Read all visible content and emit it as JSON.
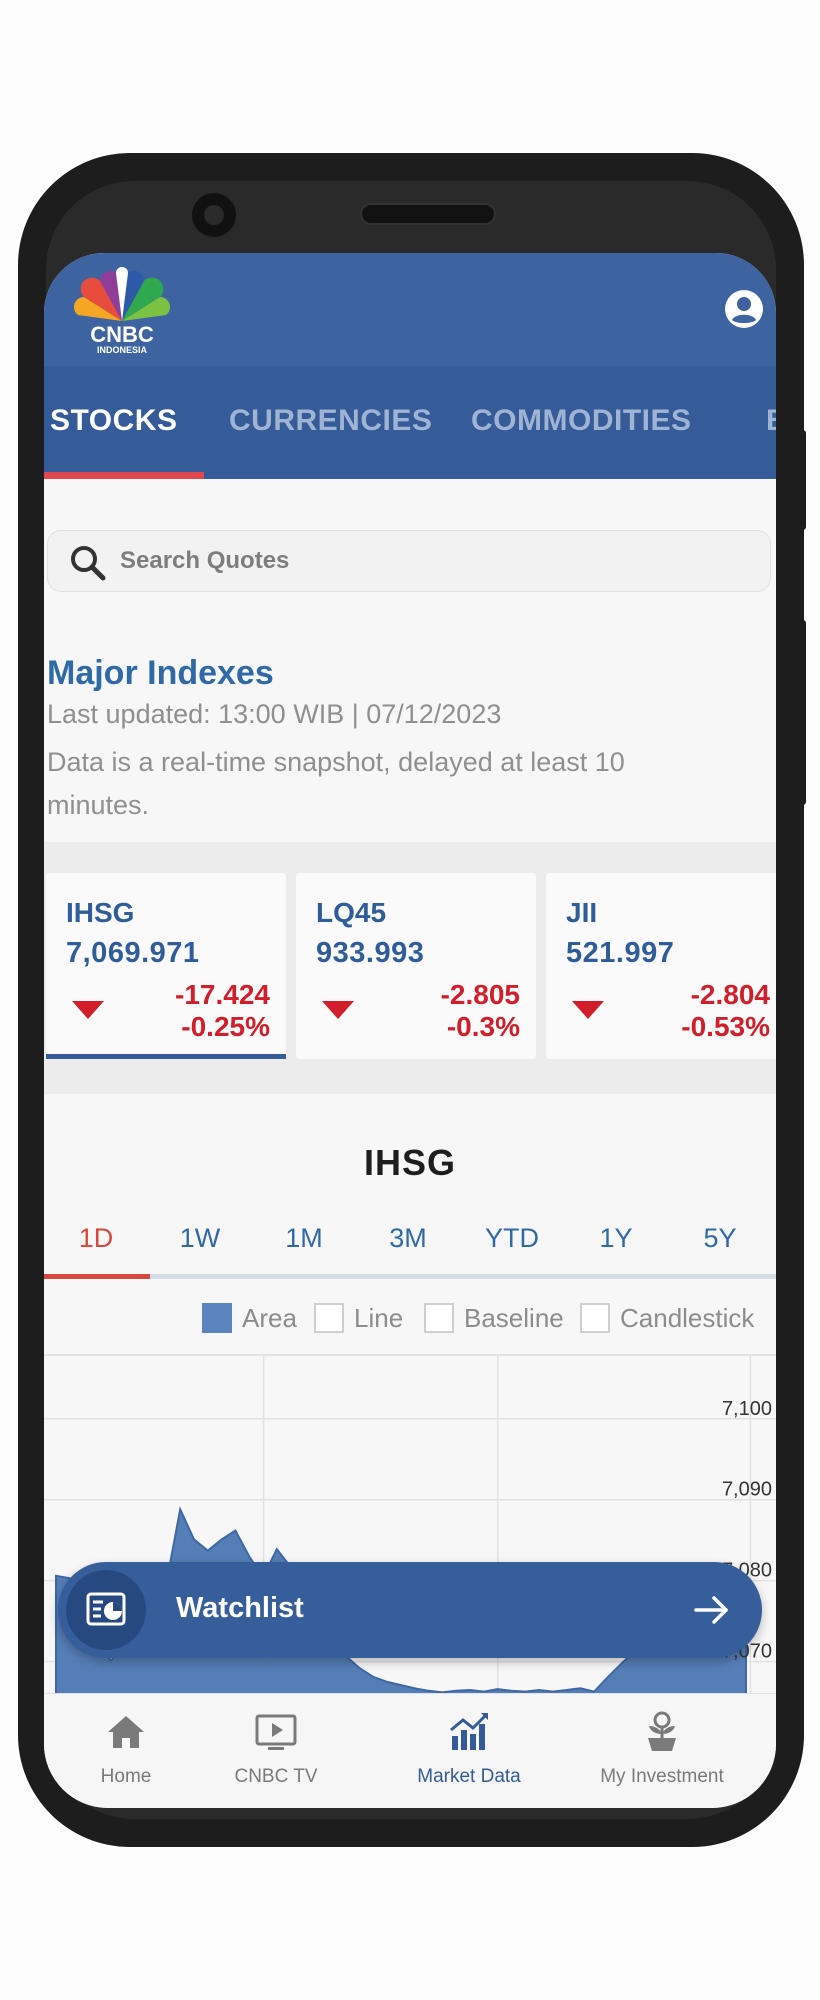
{
  "header": {
    "logo_text": "CNBC",
    "logo_subtext": "INDONESIA",
    "account_icon": "account-circle-icon"
  },
  "tabs": [
    {
      "label": "STOCKS",
      "active": true
    },
    {
      "label": "CURRENCIES",
      "active": false
    },
    {
      "label": "COMMODITIES",
      "active": false
    },
    {
      "label": "B",
      "active": false
    }
  ],
  "search": {
    "placeholder": "Search Quotes",
    "icon": "search-icon"
  },
  "major_indexes": {
    "title": "Major Indexes",
    "last_updated": "Last updated: 13:00 WIB | 07/12/2023",
    "note": "Data is a real-time snapshot, delayed at least 10 minutes."
  },
  "index_cards": [
    {
      "name": "IHSG",
      "value": "7,069.971",
      "change": "-17.424",
      "pct": "-0.25%",
      "selected": true
    },
    {
      "name": "LQ45",
      "value": "933.993",
      "change": "-2.805",
      "pct": "-0.3%",
      "selected": false
    },
    {
      "name": "JII",
      "value": "521.997",
      "change": "-2.804",
      "pct": "-0.53%",
      "selected": false
    }
  ],
  "chart_section": {
    "title": "IHSG",
    "periods": [
      "1D",
      "1W",
      "1M",
      "3M",
      "YTD",
      "1Y",
      "5Y"
    ],
    "active_period": "1D",
    "types": [
      {
        "label": "Area",
        "checked": true
      },
      {
        "label": "Line",
        "checked": false
      },
      {
        "label": "Baseline",
        "checked": false
      },
      {
        "label": "Candlestick",
        "checked": false
      }
    ]
  },
  "chart_data": {
    "type": "area",
    "y_ticks": [
      "7,100",
      "7,090",
      "7,080",
      "7,070"
    ],
    "ylim": [
      7066,
      7108
    ],
    "grid": true,
    "series": [
      {
        "color": "#4b77b1",
        "values": [
          7080.6,
          7080.3,
          7074.0,
          7072.2,
          7070.1,
          7072.6,
          7074.6,
          7076.8,
          7079.7,
          7088.8,
          7085.1,
          7083.7,
          7085.1,
          7086.2,
          7083.0,
          7080.4,
          7083.9,
          7081.7,
          7078.8,
          7076.2,
          7072.8,
          7070.7,
          7069.2,
          7068.1,
          7067.5,
          7067.1,
          7066.7,
          7066.4,
          7066.2,
          7066.4,
          7066.5,
          7066.3,
          7066.6,
          7066.4,
          7066.3,
          7066.5,
          7066.3,
          7066.5,
          7066.7,
          7066.3,
          7068.1,
          7069.8,
          7071.4,
          7071.0,
          7072.2,
          7072.0,
          7073.2,
          7074.6,
          7074.2,
          7072.2,
          7072.6
        ]
      }
    ]
  },
  "watchlist": {
    "label": "Watchlist",
    "icon": "watchlist-icon",
    "arrow_icon": "arrow-right-icon"
  },
  "bottom_nav": [
    {
      "label": "Home",
      "icon": "home-icon",
      "active": false
    },
    {
      "label": "CNBC TV",
      "icon": "tv-icon",
      "active": false
    },
    {
      "label": "Market Data",
      "icon": "market-chart-icon",
      "active": true
    },
    {
      "label": "My Investment",
      "icon": "investment-plant-icon",
      "active": false
    }
  ],
  "colors": {
    "header": "#3d63a1",
    "tab_bar": "#355b98",
    "accent_red": "#d21e2a",
    "link_blue": "#2f6aa6",
    "area_fill": "#4b77b1"
  }
}
